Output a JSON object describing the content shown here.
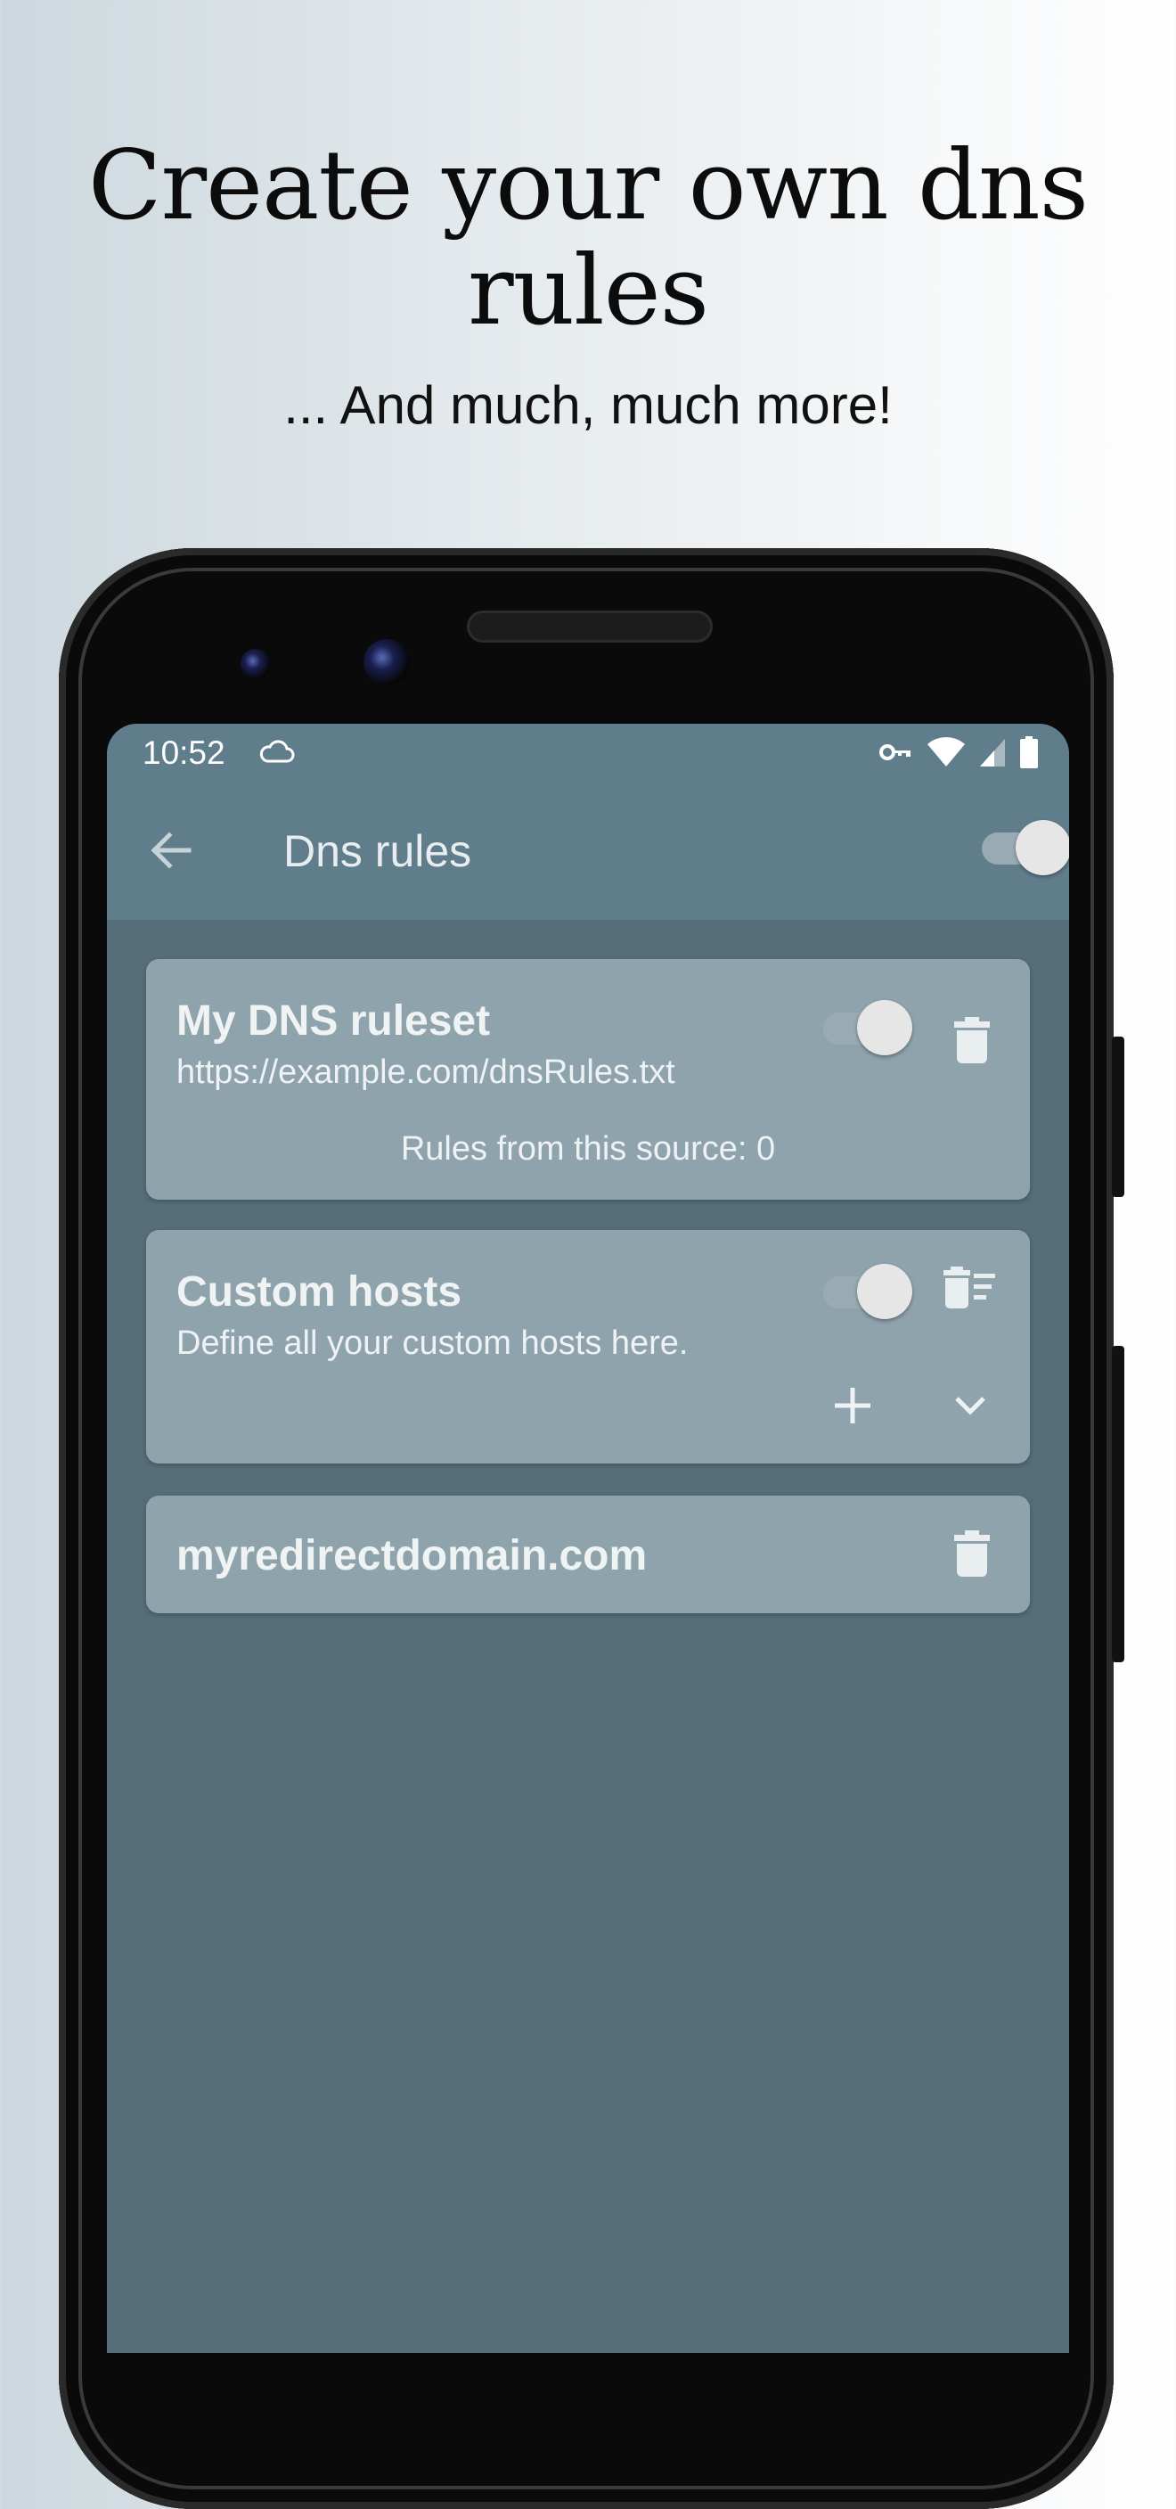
{
  "promo": {
    "headline_line1": "Create your own dns",
    "headline_line2": "rules",
    "subline": "... And much, much more!"
  },
  "status_bar": {
    "time": "10:52",
    "icons": [
      "cloud-icon",
      "vpn-key-icon",
      "wifi-icon",
      "signal-icon",
      "battery-icon"
    ]
  },
  "app_bar": {
    "title": "Dns rules",
    "back_icon": "arrow-back-icon",
    "master_switch_on": true
  },
  "cards": [
    {
      "title": "My DNS ruleset",
      "subtitle": "https://example.com/dnsRules.txt",
      "count_text": "Rules from this source: 0",
      "switch_on": true,
      "actions": [
        "delete-icon"
      ]
    },
    {
      "title": "Custom hosts",
      "subtitle": "Define all your custom hosts here.",
      "switch_on": true,
      "actions": [
        "delete-sweep-icon",
        "add-icon",
        "expand-icon"
      ]
    },
    {
      "title": "myredirectdomain.com",
      "actions": [
        "delete-icon"
      ]
    }
  ],
  "colors": {
    "app_bar": "#607d8b",
    "screen_bg": "#566e7a",
    "card_bg": "#8fa3ad"
  }
}
